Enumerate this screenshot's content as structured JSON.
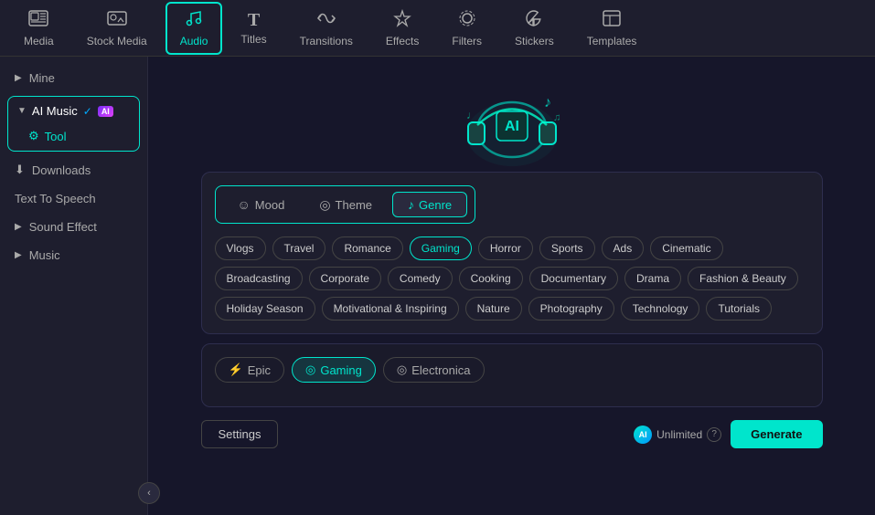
{
  "nav": {
    "items": [
      {
        "id": "media",
        "label": "Media",
        "icon": "🎬"
      },
      {
        "id": "stock-media",
        "label": "Stock Media",
        "icon": "🖼"
      },
      {
        "id": "audio",
        "label": "Audio",
        "icon": "♪",
        "active": true
      },
      {
        "id": "titles",
        "label": "Titles",
        "icon": "T"
      },
      {
        "id": "transitions",
        "label": "Transitions",
        "icon": "↔"
      },
      {
        "id": "effects",
        "label": "Effects",
        "icon": "✦"
      },
      {
        "id": "filters",
        "label": "Filters",
        "icon": "⬡"
      },
      {
        "id": "stickers",
        "label": "Stickers",
        "icon": "★"
      },
      {
        "id": "templates",
        "label": "Templates",
        "icon": "▣"
      }
    ]
  },
  "sidebar": {
    "items": [
      {
        "id": "mine",
        "label": "Mine",
        "icon": "▶",
        "chevron": true
      },
      {
        "id": "ai-music",
        "label": "AI Music",
        "icon": "◎",
        "badge": "AI",
        "group": true
      },
      {
        "id": "tool",
        "label": "Tool",
        "icon": "⚙",
        "child": true
      },
      {
        "id": "downloads",
        "label": "Downloads",
        "icon": "⬇"
      },
      {
        "id": "text-to-speech",
        "label": "Text To Speech",
        "icon": ""
      },
      {
        "id": "sound-effect",
        "label": "Sound Effect",
        "icon": "▶",
        "chevron": true
      },
      {
        "id": "music",
        "label": "Music",
        "icon": "▶",
        "chevron": true
      }
    ],
    "collapse_icon": "‹"
  },
  "main": {
    "tabs": [
      {
        "id": "mood",
        "label": "Mood",
        "icon": "☺",
        "active": false
      },
      {
        "id": "theme",
        "label": "Theme",
        "icon": "◎",
        "active": false
      },
      {
        "id": "genre",
        "label": "Genre",
        "icon": "♪",
        "active": true
      }
    ],
    "genre_chips": [
      {
        "id": "vlogs",
        "label": "Vlogs"
      },
      {
        "id": "travel",
        "label": "Travel"
      },
      {
        "id": "romance",
        "label": "Romance"
      },
      {
        "id": "gaming",
        "label": "Gaming",
        "active": true
      },
      {
        "id": "horror",
        "label": "Horror"
      },
      {
        "id": "sports",
        "label": "Sports"
      },
      {
        "id": "ads",
        "label": "Ads"
      },
      {
        "id": "cinematic",
        "label": "Cinematic"
      },
      {
        "id": "broadcasting",
        "label": "Broadcasting"
      },
      {
        "id": "corporate",
        "label": "Corporate"
      },
      {
        "id": "comedy",
        "label": "Comedy"
      },
      {
        "id": "cooking",
        "label": "Cooking"
      },
      {
        "id": "documentary",
        "label": "Documentary"
      },
      {
        "id": "drama",
        "label": "Drama"
      },
      {
        "id": "fashion-beauty",
        "label": "Fashion & Beauty"
      },
      {
        "id": "holiday-season",
        "label": "Holiday Season"
      },
      {
        "id": "motivational-inspiring",
        "label": "Motivational & Inspiring"
      },
      {
        "id": "nature",
        "label": "Nature"
      },
      {
        "id": "photography",
        "label": "Photography"
      },
      {
        "id": "technology",
        "label": "Technology"
      },
      {
        "id": "tutorials",
        "label": "Tutorials"
      }
    ],
    "mood_chips": [
      {
        "id": "epic",
        "label": "Epic",
        "icon": "⚡"
      },
      {
        "id": "gaming",
        "label": "Gaming",
        "icon": "◎",
        "active": true
      },
      {
        "id": "electronica",
        "label": "Electronica",
        "icon": "◎"
      }
    ],
    "settings_label": "Settings",
    "unlimited_label": "Unlimited",
    "generate_label": "Generate"
  }
}
